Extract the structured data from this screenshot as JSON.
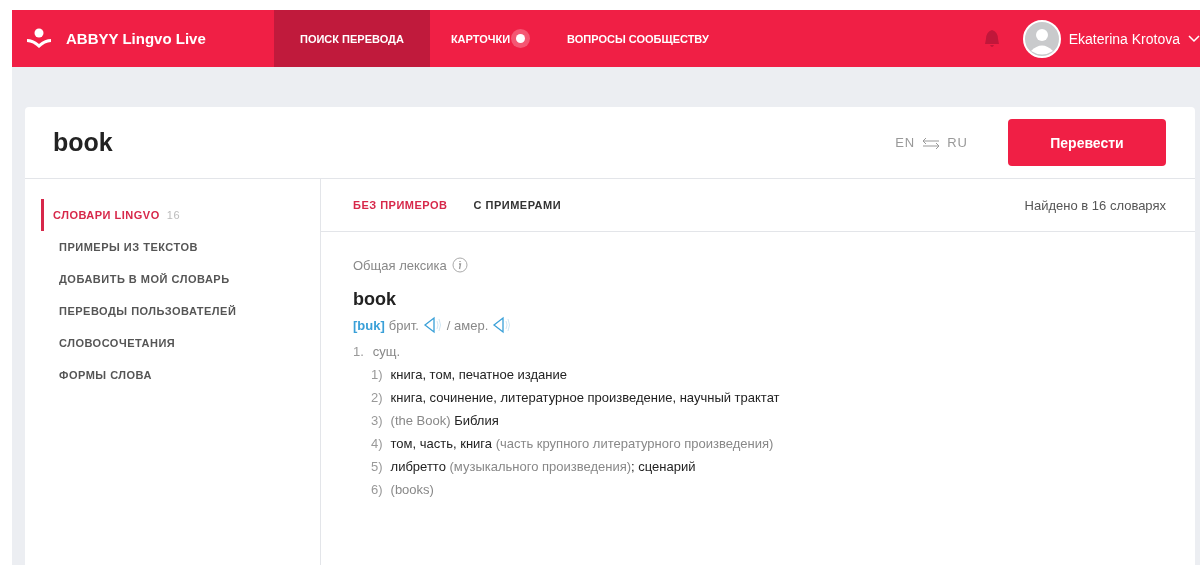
{
  "header": {
    "logo": "ABBYY Lingvo Live",
    "nav": [
      {
        "label": "ПОИСК ПЕРЕВОДА",
        "selected": true,
        "dot": false
      },
      {
        "label": "КАРТОЧКИ",
        "selected": false,
        "dot": true
      },
      {
        "label": "ВОПРОСЫ СООБЩЕСТВУ",
        "selected": false,
        "dot": false
      }
    ],
    "user": "Ekaterina Krotova"
  },
  "search": {
    "value": "book",
    "lang_from": "EN",
    "lang_to": "RU",
    "button": "Перевести"
  },
  "sidebar": {
    "items": [
      {
        "label": "СЛОВАРИ LINGVO",
        "count": "16",
        "selected": true
      },
      {
        "label": "ПРИМЕРЫ ИЗ ТЕКСТОВ",
        "selected": false
      },
      {
        "label": "ДОБАВИТЬ В МОЙ СЛОВАРЬ",
        "selected": false
      },
      {
        "label": "ПЕРЕВОДЫ ПОЛЬЗОВАТЕЛЕЙ",
        "selected": false
      },
      {
        "label": "СЛОВОСОЧЕТАНИЯ",
        "selected": false
      },
      {
        "label": "ФОРМЫ СЛОВА",
        "selected": false
      }
    ]
  },
  "tabs": [
    {
      "label": "БЕЗ ПРИМЕРОВ",
      "selected": true
    },
    {
      "label": "С ПРИМЕРАМИ",
      "selected": false
    }
  ],
  "found": "Найдено в 16 словарях",
  "entry": {
    "dictionary": "Общая лексика",
    "word": "book",
    "transcription": "[buk]",
    "brit": "брит.",
    "amer": "/ амер.",
    "pos_number": "1.",
    "pos": "сущ.",
    "meanings": [
      {
        "number": "1)",
        "parts": [
          {
            "kind": "text",
            "text": "книга, том, печатное издание"
          }
        ]
      },
      {
        "number": "2)",
        "parts": [
          {
            "kind": "text",
            "text": "книга, сочинение, литературное произведение, научный трактат"
          }
        ]
      },
      {
        "number": "3)",
        "parts": [
          {
            "kind": "note",
            "text": "(the Book)"
          },
          {
            "kind": "text",
            "text": "Библия"
          }
        ]
      },
      {
        "number": "4)",
        "parts": [
          {
            "kind": "text",
            "text": "том, часть, книга"
          },
          {
            "kind": "note",
            "text": "(часть крупного литературного произведения)"
          }
        ]
      },
      {
        "number": "5)",
        "parts": [
          {
            "kind": "text",
            "text": "либретто"
          },
          {
            "kind": "note",
            "text": "(музыкального произведения)"
          },
          {
            "kind": "text",
            "text": "; сценарий"
          }
        ]
      },
      {
        "number": "6)",
        "parts": [
          {
            "kind": "note",
            "text": "(books)"
          }
        ]
      }
    ]
  }
}
